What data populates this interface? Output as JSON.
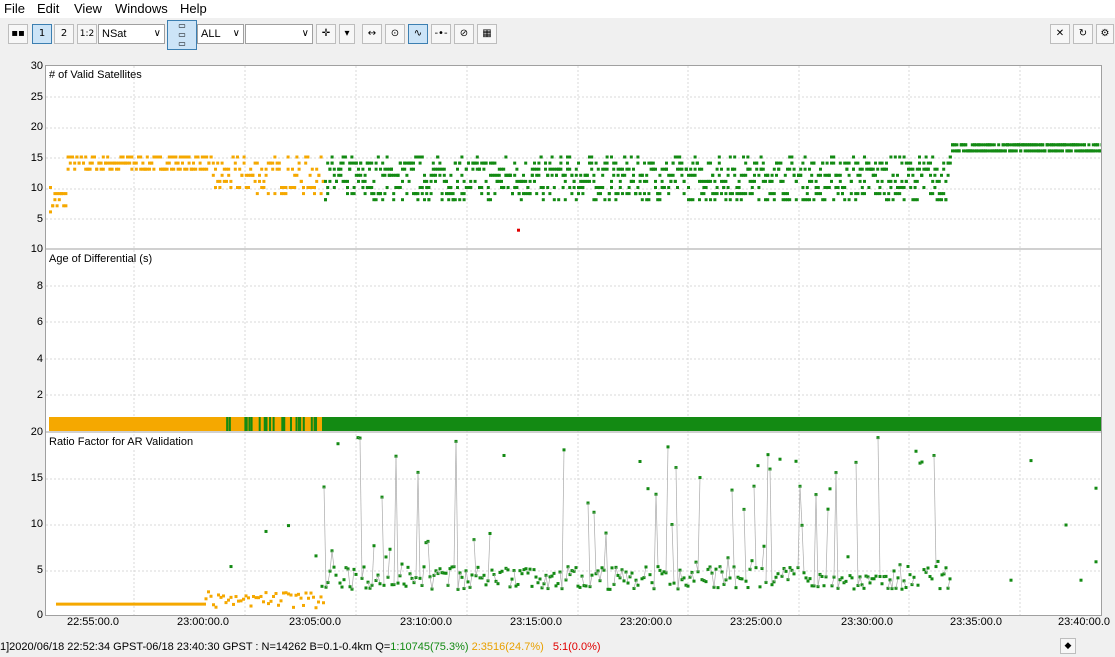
{
  "menu": [
    "File",
    "Edit",
    "View",
    "Windows",
    "Help"
  ],
  "toolbar": {
    "btn_1": "1",
    "btn_2": "2",
    "btn_12": "1:2",
    "plot_type": "NSat",
    "quality_filter": "ALL",
    "satellite_select": ""
  },
  "panels": {
    "nsat_title": "# of Valid Satellites",
    "age_title": "Age of Differential (s)",
    "ratio_title": "Ratio Factor for AR Validation"
  },
  "y_ticks": {
    "nsat": [
      "30",
      "25",
      "20",
      "15",
      "10",
      "5"
    ],
    "age": [
      "10",
      "8",
      "6",
      "4",
      "2"
    ],
    "ratio": [
      "20",
      "15",
      "10",
      "5",
      "0"
    ]
  },
  "x_ticks": [
    "22:55:00.0",
    "23:00:00.0",
    "23:05:00.0",
    "23:10:00.0",
    "23:15:00.0",
    "23:20:00.0",
    "23:25:00.0",
    "23:30:00.0",
    "23:35:00.0",
    "23:40:00.0"
  ],
  "status": {
    "range": "1]2020/06/18 22:52:34 GPST-06/18 23:40:30 GPST : N=14262 B=0.1-0.4km Q=",
    "q1": "1:10745(75.3%)",
    "q2": "2:3516(24.7%)",
    "q5": "5:1(0.0%)"
  },
  "colors": {
    "fix": "#138a13",
    "float": "#f5a800",
    "single": "#e00000",
    "line": "#aaaaaa"
  }
}
